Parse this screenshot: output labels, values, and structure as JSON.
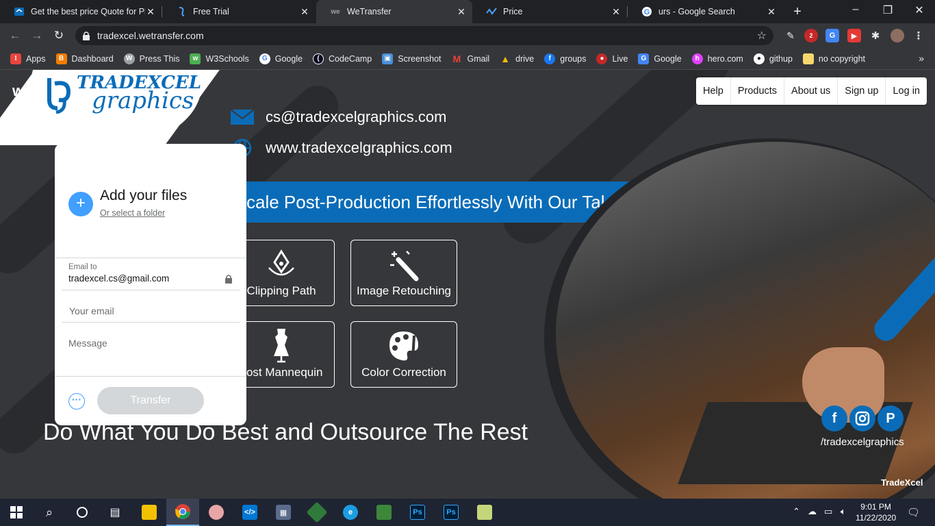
{
  "browser": {
    "tabs": [
      {
        "title": "Get the best price Quote for Ph",
        "favicon": "tradexcel-icon",
        "active": false
      },
      {
        "title": "Free Trial",
        "favicon": "tradexcel-icon",
        "active": false
      },
      {
        "title": "WeTransfer",
        "favicon": "wetransfer-icon",
        "active": true
      },
      {
        "title": "Price",
        "favicon": "wave-icon",
        "active": false
      },
      {
        "title": "urs - Google Search",
        "favicon": "google-icon",
        "active": false
      }
    ],
    "url": "tradexcel.wetransfer.com",
    "extension_badge": "2",
    "bookmarks": [
      {
        "label": "Apps",
        "icon": "apps-grid-icon",
        "color": "#e8453c"
      },
      {
        "label": "Dashboard",
        "icon": "blogger-icon",
        "color": "#f57d00"
      },
      {
        "label": "Press This",
        "icon": "wordpress-icon",
        "color": "#9aa0a6"
      },
      {
        "label": "W3Schools",
        "icon": "w3schools-icon",
        "color": "#4caf50"
      },
      {
        "label": "Google",
        "icon": "google-icon",
        "color": "#ffffff"
      },
      {
        "label": "CodeCamp",
        "icon": "codecamp-icon",
        "color": "#0a0a23"
      },
      {
        "label": "Screenshot",
        "icon": "screenshot-icon",
        "color": "#4a90d9"
      },
      {
        "label": "Gmail",
        "icon": "gmail-icon",
        "color": "#ea4335"
      },
      {
        "label": "drive",
        "icon": "drive-icon",
        "color": "#fbbc04"
      },
      {
        "label": "groups",
        "icon": "facebook-icon",
        "color": "#1877f2"
      },
      {
        "label": "Live",
        "icon": "live-icon",
        "color": "#c62828"
      },
      {
        "label": "Google",
        "icon": "google-translate-icon",
        "color": "#4285f4"
      },
      {
        "label": "hero.com",
        "icon": "hero-icon",
        "color": "#e040fb"
      },
      {
        "label": "githup",
        "icon": "github-icon",
        "color": "#ffffff"
      },
      {
        "label": "no copyright",
        "icon": "folder-icon",
        "color": "#f5d76e"
      }
    ]
  },
  "page": {
    "logo_line1": "TRADEXCEL",
    "logo_line2": "graphics",
    "we_logo": "we",
    "email": "cs@tradexcelgraphics.com",
    "website": "www.tradexcelgraphics.com",
    "banner": "cale Post-Production Effortlessly With Our Talent and Technology",
    "services": [
      "Clipping Path",
      "Image Retouching",
      "host Mannequin",
      "Color Correction"
    ],
    "tagline": "Do What You Do Best and Outsource The Rest",
    "nav": [
      "Help",
      "Products",
      "About us",
      "Sign up",
      "Log in"
    ],
    "social_handle": "/tradexcelgraphics",
    "footer_brand": "TradeXcel",
    "accent": "#0a6cb8"
  },
  "transfer": {
    "add_title": "Add your files",
    "folder_link": "Or select a folder",
    "email_to_label": "Email to",
    "email_to_value": "tradexcel.cs@gmail.com",
    "your_email_placeholder": "Your email",
    "message_placeholder": "Message",
    "transfer_label": "Transfer",
    "more_label": "···"
  },
  "taskbar": {
    "time": "9:01 PM",
    "date": "11/22/2020"
  }
}
